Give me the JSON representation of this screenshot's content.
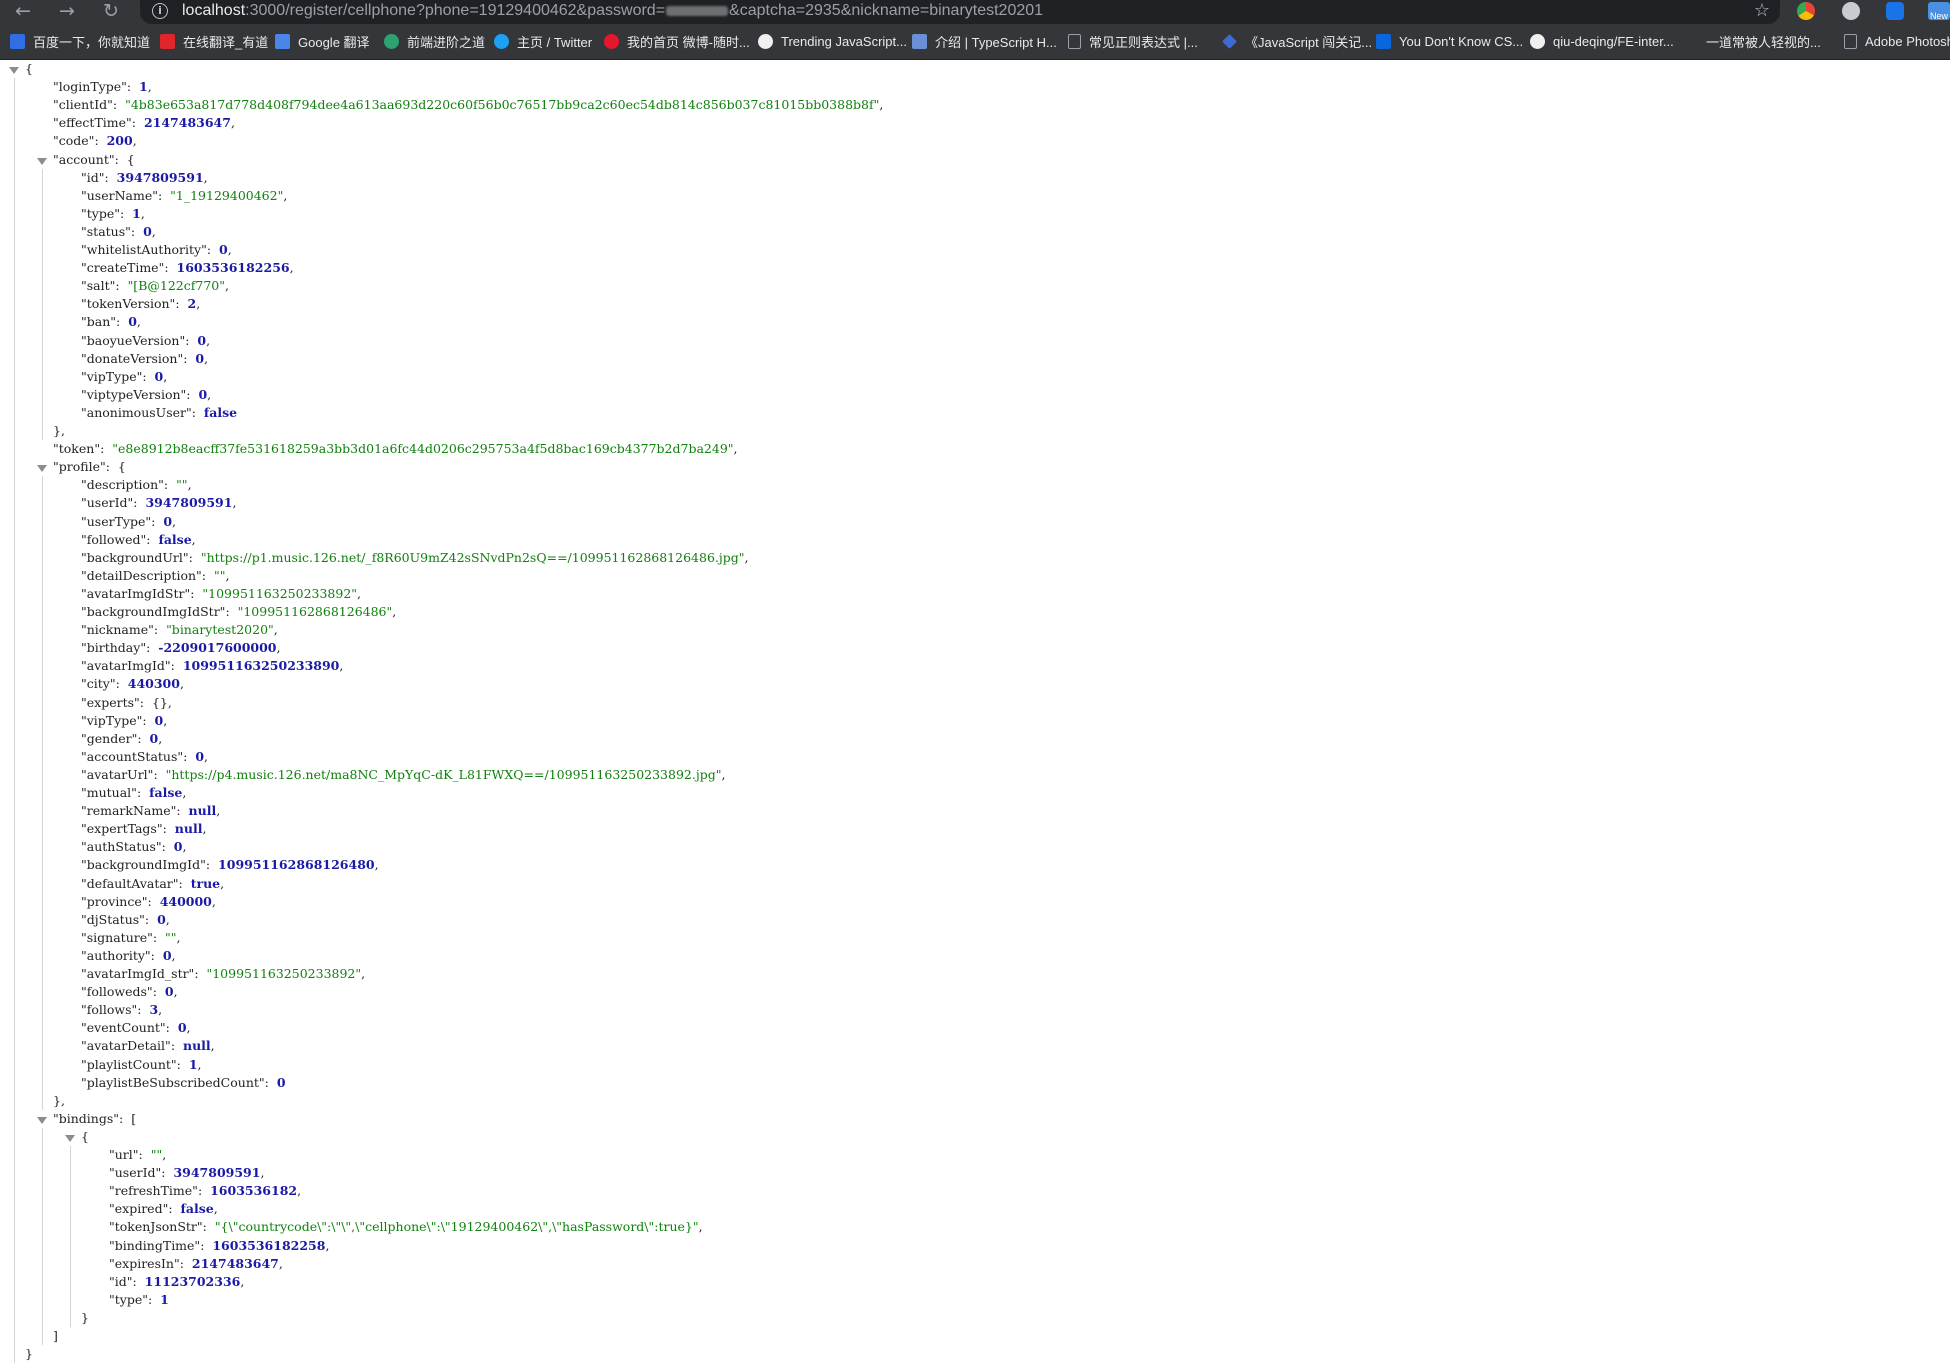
{
  "browser": {
    "url_host": "localhost",
    "url_rest_before_blur": ":3000/register/cellphone?phone=19129400462&password=",
    "url_rest_after_blur": "&captcha=2935&nickname=binarytest20201",
    "ext_badge": "New"
  },
  "bookmarks": [
    {
      "label": "百度一下，你就知道",
      "color": "#2f6ee5"
    },
    {
      "label": "在线翻译_有道",
      "color": "#e0252b"
    },
    {
      "label": "Google 翻译",
      "color": "#4a86e8"
    },
    {
      "label": "前端进阶之道",
      "color": "#2ea36f"
    },
    {
      "label": "主页 / Twitter",
      "color": "#1da1f2"
    },
    {
      "label": "我的首页 微博-随时...",
      "color": "#e6162d"
    },
    {
      "label": "Trending JavaScript...",
      "color": "#f0f0f0"
    },
    {
      "label": "介绍 | TypeScript H...",
      "color": "#6b8fd6"
    },
    {
      "label": "常见正则表达式 |...",
      "color": "#9aa0a6"
    },
    {
      "label": "《JavaScript 闯关记...",
      "color": "#3d6bd6"
    },
    {
      "label": "You Don't Know CS...",
      "color": "#0a66dc"
    },
    {
      "label": "qiu-deqing/FE-inter...",
      "color": "#f0f0f0"
    },
    {
      "label": "一道常被人轻视的...",
      "color": "#35363a"
    },
    {
      "label": "Adobe Photosho",
      "color": "#9aa0a6"
    }
  ],
  "json": {
    "loginType": 1,
    "clientId": "4b83e653a817d778d408f794dee4a613aa693d220c60f56b0c76517bb9ca2c60ec54db814c856b037c81015bb0388b8f",
    "effectTime": 2147483647,
    "code": 200,
    "account": {
      "id": 3947809591,
      "userName": "1_19129400462",
      "type": 1,
      "status": 0,
      "whitelistAuthority": 0,
      "createTime": 1603536182256,
      "salt": "[B@122cf770",
      "tokenVersion": 2,
      "ban": 0,
      "baoyueVersion": 0,
      "donateVersion": 0,
      "vipType": 0,
      "viptypeVersion": 0,
      "anonimousUser": false
    },
    "token": "e8e8912b8eacff37fe531618259a3bb3d01a6fc44d0206c295753a4f5d8bac169cb4377b2d7ba249",
    "profile": {
      "description": "",
      "userId": 3947809591,
      "userType": 0,
      "followed": false,
      "backgroundUrl": "https://p1.music.126.net/_f8R60U9mZ42sSNvdPn2sQ==/109951162868126486.jpg",
      "detailDescription": "",
      "avatarImgIdStr": "109951163250233892",
      "backgroundImgIdStr": "109951162868126486",
      "nickname": "binarytest2020",
      "birthday": -2209017600000,
      "avatarImgId": 109951163250233890,
      "city": 440300,
      "experts": "{}",
      "vipType": 0,
      "gender": 0,
      "accountStatus": 0,
      "avatarUrl": "https://p4.music.126.net/ma8NC_MpYqC-dK_L81FWXQ==/109951163250233892.jpg",
      "mutual": false,
      "remarkName": null,
      "expertTags": null,
      "authStatus": 0,
      "backgroundImgId": 109951162868126480,
      "defaultAvatar": true,
      "province": 440000,
      "djStatus": 0,
      "signature": "",
      "authority": 0,
      "avatarImgId_str": "109951163250233892",
      "followeds": 0,
      "follows": 3,
      "eventCount": 0,
      "avatarDetail": null,
      "playlistCount": 1,
      "playlistBeSubscribedCount": 0
    },
    "bindings": [
      {
        "url": "",
        "userId": 3947809591,
        "refreshTime": 1603536182,
        "expired": false,
        "tokenJsonStr": "{\\\"countrycode\\\":\\\"\\\",\\\"cellphone\\\":\\\"19129400462\\\",\\\"hasPassword\\\":true}",
        "bindingTime": 1603536182258,
        "expiresIn": 2147483647,
        "id": 11123702336,
        "type": 1
      }
    ]
  }
}
